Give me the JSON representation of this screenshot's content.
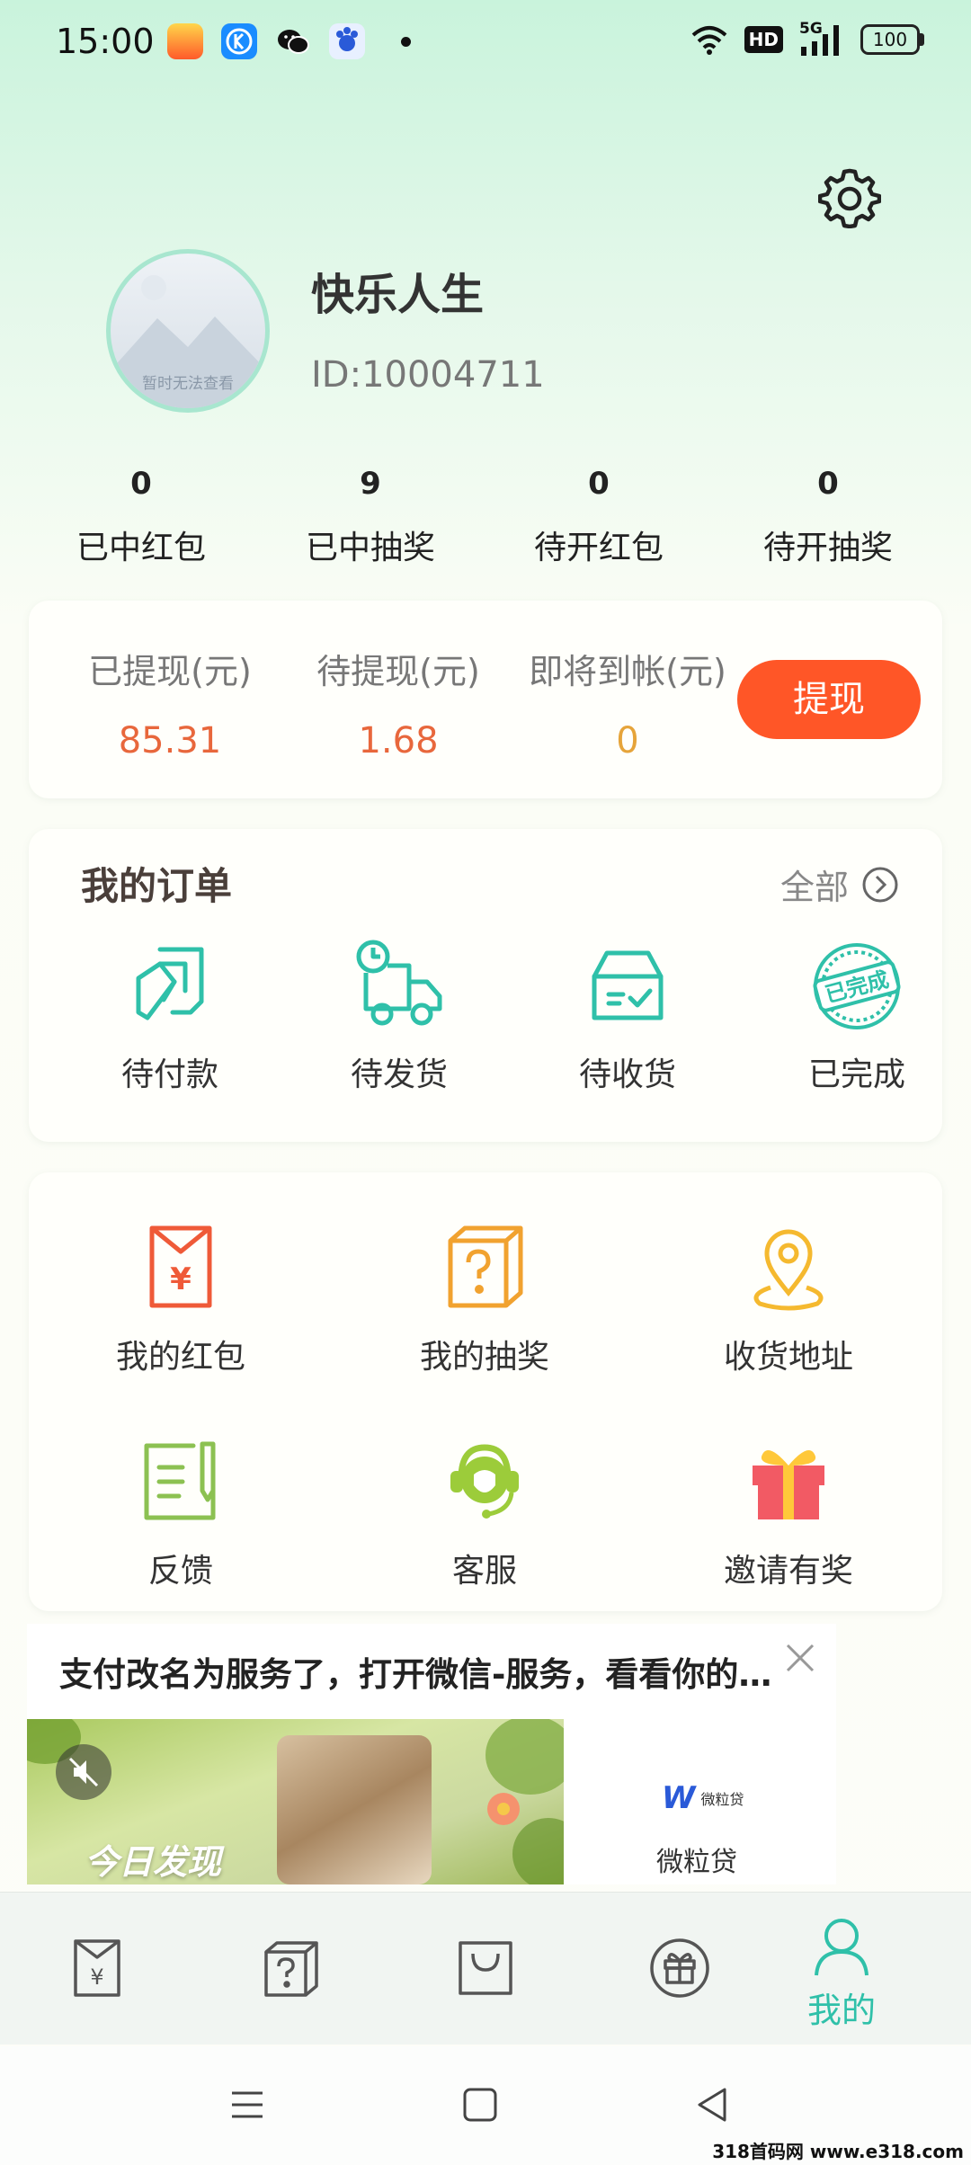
{
  "status_bar": {
    "time": "15:00",
    "network": "5G",
    "battery": "100"
  },
  "profile": {
    "avatar_placeholder": "暂时无法查看",
    "name": "快乐人生",
    "id": "ID:10004711"
  },
  "stats": [
    {
      "value": "0",
      "label": "已中红包"
    },
    {
      "value": "9",
      "label": "已中抽奖"
    },
    {
      "value": "0",
      "label": "待开红包"
    },
    {
      "value": "0",
      "label": "待开抽奖"
    }
  ],
  "wallet": {
    "items": [
      {
        "label": "已提现(元)",
        "value": "85.31",
        "color": "#e8673c"
      },
      {
        "label": "待提现(元)",
        "value": "1.68",
        "color": "#e8673c"
      },
      {
        "label": "即将到帐(元)",
        "value": "0",
        "color": "#e6a43a"
      }
    ],
    "withdraw_label": "提现"
  },
  "orders": {
    "title": "我的订单",
    "all_label": "全部",
    "items": [
      {
        "label": "待付款",
        "icon": "card-payment-icon"
      },
      {
        "label": "待发货",
        "icon": "delivery-truck-icon"
      },
      {
        "label": "待收货",
        "icon": "package-box-icon"
      },
      {
        "label": "已完成",
        "icon": "completed-stamp-icon",
        "stamp_text": "已完成"
      }
    ]
  },
  "services": {
    "items": [
      {
        "label": "我的红包",
        "icon": "red-envelope-icon"
      },
      {
        "label": "我的抽奖",
        "icon": "mystery-box-icon"
      },
      {
        "label": "收货地址",
        "icon": "location-pin-icon"
      },
      {
        "label": "反馈",
        "icon": "feedback-edit-icon"
      },
      {
        "label": "客服",
        "icon": "customer-service-icon"
      },
      {
        "label": "邀请有奖",
        "icon": "gift-icon"
      }
    ]
  },
  "ad": {
    "text": "支付改名为服务了，打开微信-服务，看看你的…",
    "image_title": "今日发现",
    "brand_small": "微粒贷",
    "brand_name": "微粒贷"
  },
  "tabbar": {
    "items": [
      {
        "icon": "red-envelope-tab-icon"
      },
      {
        "icon": "mystery-box-tab-icon"
      },
      {
        "icon": "shopping-bag-tab-icon"
      },
      {
        "icon": "gift-tab-icon"
      },
      {
        "icon": "profile-tab-icon",
        "label": "我的",
        "active": true
      }
    ],
    "active_color": "#2fc0a9"
  },
  "watermark": "318首码网 www.e318.com"
}
